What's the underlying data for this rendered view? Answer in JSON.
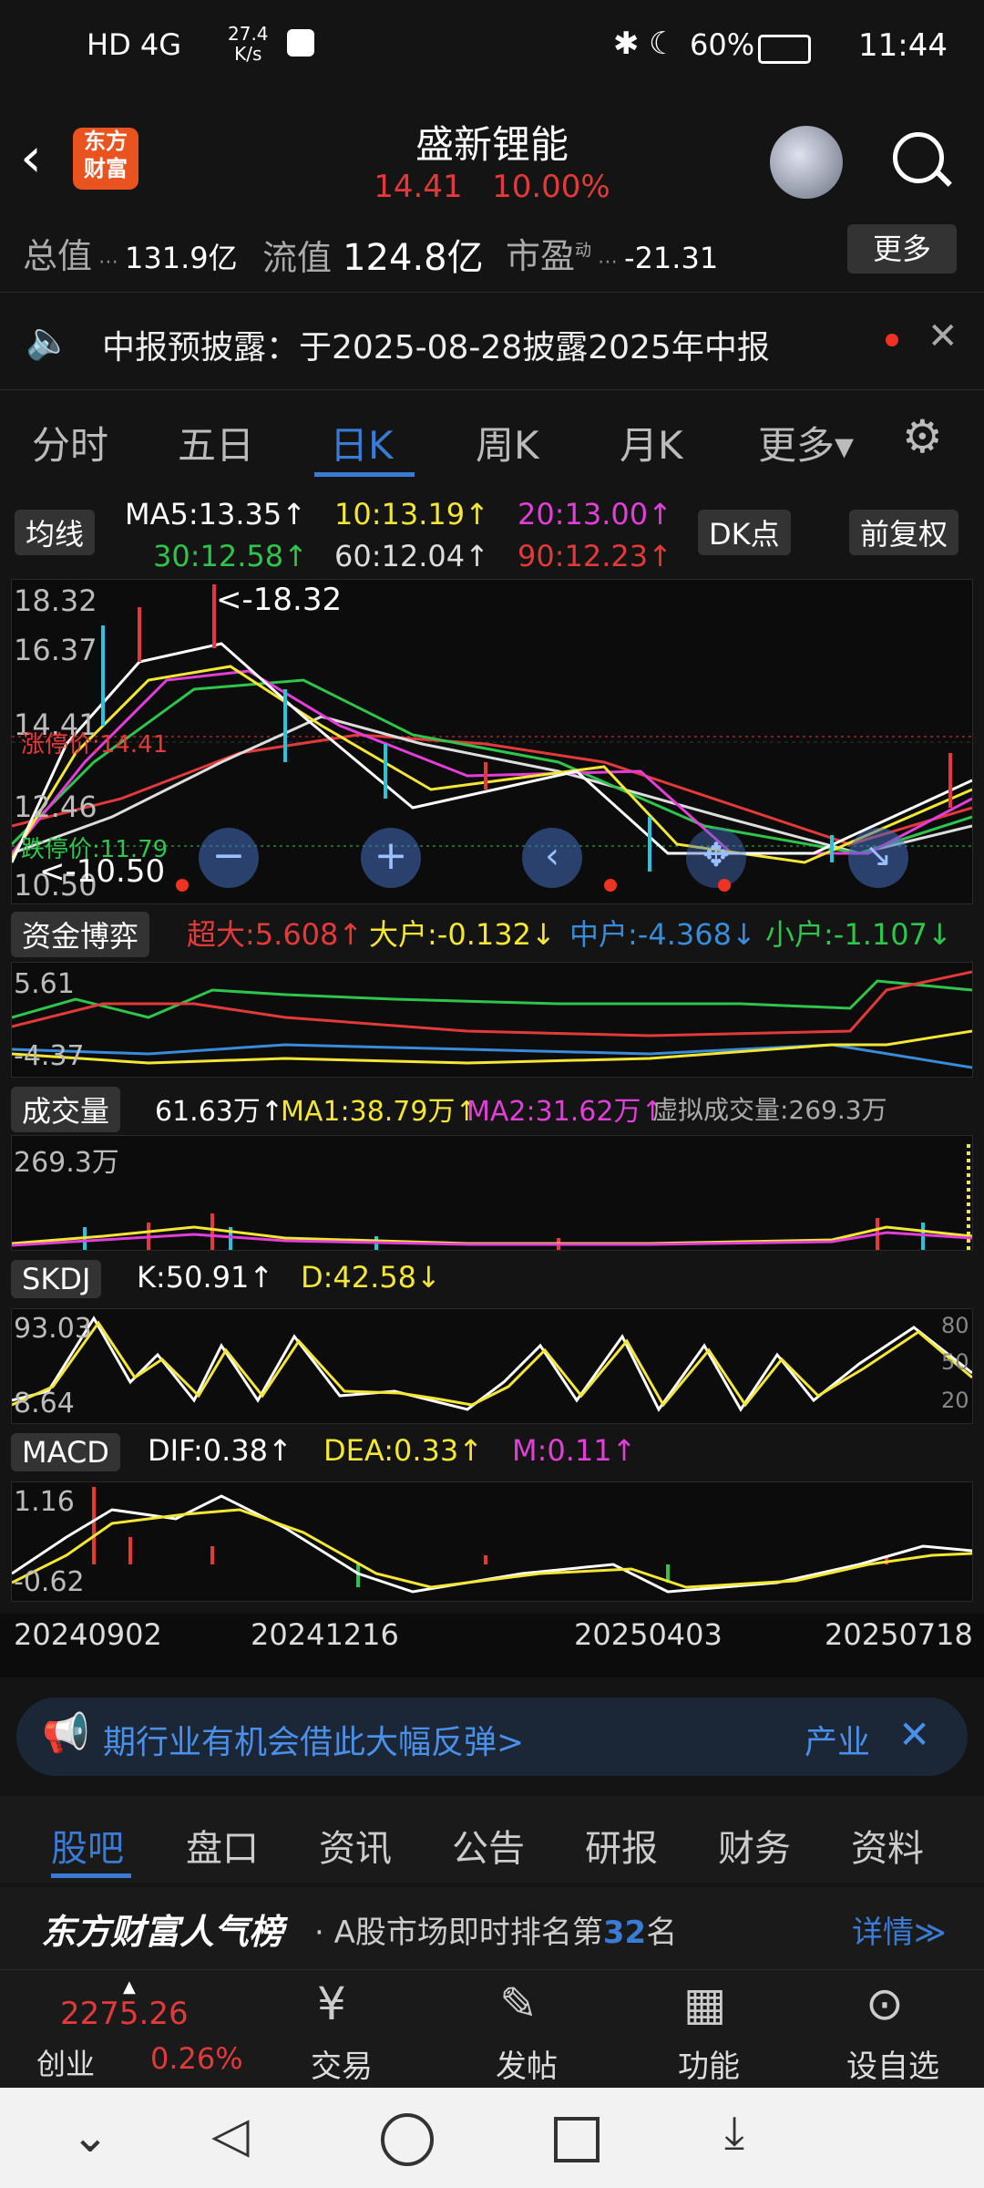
{
  "status": {
    "net": "HD 4G",
    "speed": "27.4\nK/s",
    "battery": "60%",
    "time": "11:44"
  },
  "header": {
    "logo": "东方\n财富",
    "title": "盛新锂能",
    "price": "14.41",
    "change": "10.00%"
  },
  "stats": {
    "total_label": "总值",
    "total_value": "131.9亿",
    "float_label": "流值",
    "float_value": "124.8亿",
    "pe_label": "市盈",
    "pe_sup": "动",
    "pe_value": "-21.31",
    "more": "更多"
  },
  "notice": {
    "text": "中报预披露：于2025-08-28披露2025年中报"
  },
  "tabs": [
    "分时",
    "五日",
    "日K",
    "周K",
    "月K",
    "更多▾"
  ],
  "ma": {
    "label": "均线",
    "ma5": "MA5:13.35↑",
    "ma10": "10:13.19↑",
    "ma20": "20:13.00↑",
    "ma30": "30:12.58↑",
    "ma60": "60:12.04↑",
    "ma90": "90:12.23↑",
    "dk": "DK点",
    "adj": "前复权"
  },
  "kline": {
    "y_top": "18.32",
    "y2": "16.37",
    "y3": "14.41",
    "y4": "12.46",
    "y_bottom": "10.50",
    "high": "<-18.32",
    "low": "<-10.50",
    "limit_up": "涨停价:14.41",
    "limit_down": "跌停价:11.79"
  },
  "fund": {
    "label": "资金博弈",
    "super": "超大:5.608↑",
    "big": "大户:-0.132↓",
    "mid": "中户:-4.368↓",
    "small": "小户:-1.107↓",
    "y_top": "5.61",
    "y_bottom": "-4.37"
  },
  "vol": {
    "label": "成交量",
    "val": "61.63万↑",
    "ma1": "MA1:38.79万↑",
    "ma2": "MA2:31.62万↑",
    "virt": "虚拟成交量:269.3万",
    "y_top": "269.3万"
  },
  "skdj": {
    "label": "SKDJ",
    "k": "K:50.91↑",
    "d": "D:42.58↓",
    "y_top": "93.03",
    "y_bottom": "8.64",
    "r80": "80",
    "r50": "50",
    "r20": "20"
  },
  "macd": {
    "label": "MACD",
    "dif": "DIF:0.38↑",
    "dea": "DEA:0.33↑",
    "m": "M:0.11↑",
    "y_top": "1.16",
    "y_bottom": "-0.62"
  },
  "dates": [
    "20240902",
    "20241216",
    "20250403",
    "20250718"
  ],
  "banner": {
    "text": "期行业有机会借此大幅反弹>",
    "tag": "产业"
  },
  "bottom_tabs": [
    "股吧",
    "盘口",
    "资讯",
    "公告",
    "研报",
    "财务",
    "资料"
  ],
  "rank": {
    "title": "东方财富人气榜",
    "text": "· A股市场即时排名第",
    "num": "32",
    "suffix": "名",
    "detail": "详情≫"
  },
  "dock": {
    "index_value": "2275.26",
    "index_name": "创业",
    "index_change": "0.26%",
    "trade": "交易",
    "post": "发帖",
    "func": "功能",
    "watch": "设自选"
  }
}
